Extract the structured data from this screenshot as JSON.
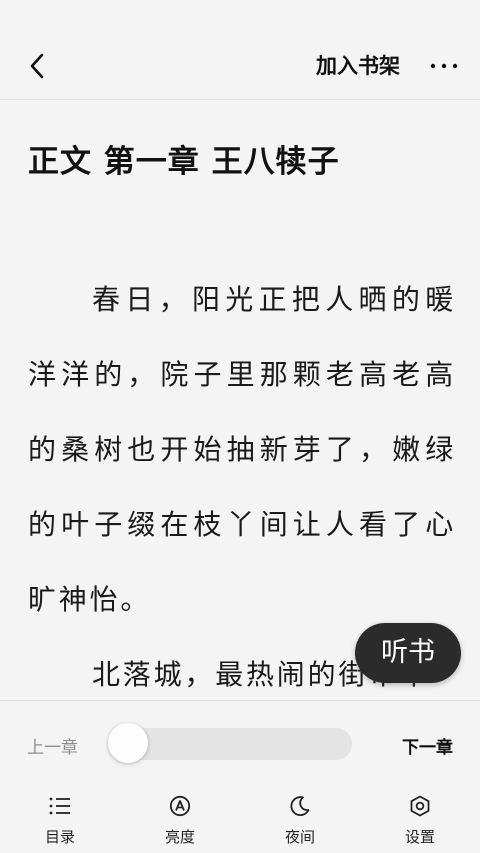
{
  "header": {
    "add_to_shelf": "加入书架"
  },
  "chapter": {
    "title": "正文 第一章 王八犊子",
    "paragraphs": [
      "春日，阳光正把人晒的暖洋洋的，院子里那颗老高老高的桑树也开始抽新芽了，嫩绿的叶子缀在枝丫间让人看了心旷神怡。",
      "北落城，最热闹的街市中"
    ]
  },
  "floating": {
    "listen_label": "听书"
  },
  "progress": {
    "prev_label": "上一章",
    "next_label": "下一章",
    "value": 0.0
  },
  "toolbar": {
    "items": [
      {
        "label": "目录",
        "icon": "list-icon"
      },
      {
        "label": "亮度",
        "icon": "brightness-icon"
      },
      {
        "label": "夜间",
        "icon": "moon-icon"
      },
      {
        "label": "设置",
        "icon": "settings-icon"
      }
    ]
  }
}
